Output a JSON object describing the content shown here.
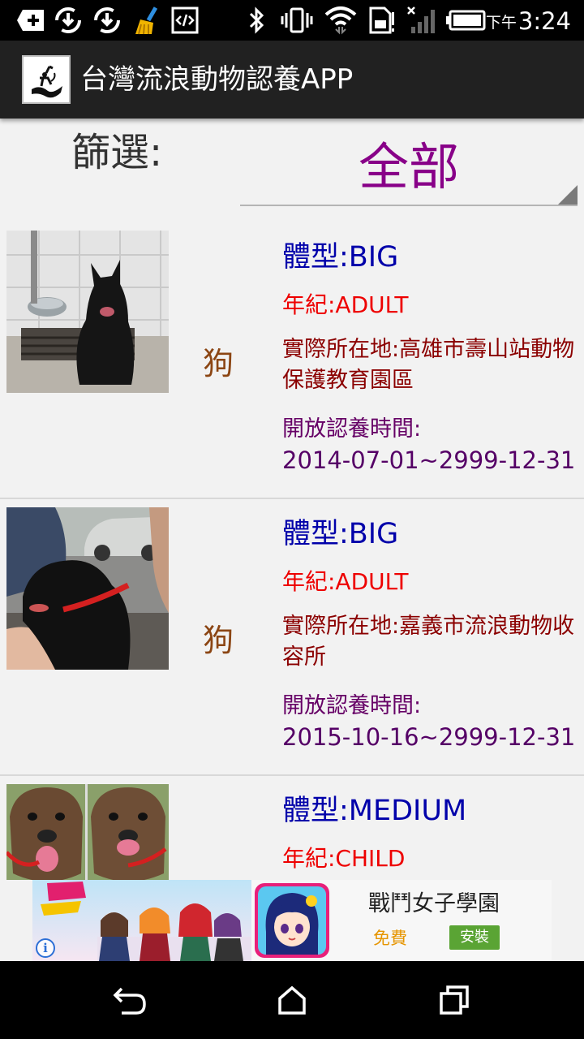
{
  "status_bar": {
    "time_prefix": "下午",
    "time": "3:24",
    "icons": [
      "add-icon",
      "sync-icon",
      "sync-icon",
      "cleaner-broom-icon",
      "developer-code-icon",
      "bluetooth-icon",
      "vibrate-icon",
      "wifi-icon",
      "sim-card-icon",
      "signal-icon",
      "battery-icon"
    ]
  },
  "app_bar": {
    "title": "台灣流浪動物認養APP",
    "icon": "app-logo-icon"
  },
  "filter": {
    "label": "篩選:",
    "selected": "全部"
  },
  "animals": [
    {
      "species": "狗",
      "size": "體型:BIG",
      "age": "年紀:ADULT",
      "place": "實際所在地:高雄市壽山站動物保護教育園區",
      "open_label": "開放認養時間:",
      "open_dates": "2014-07-01~2999-12-31"
    },
    {
      "species": "狗",
      "size": "體型:BIG",
      "age": "年紀:ADULT",
      "place": "實際所在地:嘉義市流浪動物收容所",
      "open_label": "開放認養時間:",
      "open_dates": "2015-10-16~2999-12-31"
    },
    {
      "species": "",
      "size": "體型:MEDIUM",
      "age": "年紀:CHILD",
      "place": "",
      "open_label": "",
      "open_dates": ""
    }
  ],
  "ad": {
    "title": "戰鬥女子學園",
    "price": "免費",
    "install_label": "安裝",
    "info_symbol": "i"
  },
  "colors": {
    "accent_purple": "#880088",
    "size_blue": "#0000aa",
    "age_red": "#ee0000",
    "place_darkred": "#8b0000",
    "install_green": "#5aa434"
  }
}
